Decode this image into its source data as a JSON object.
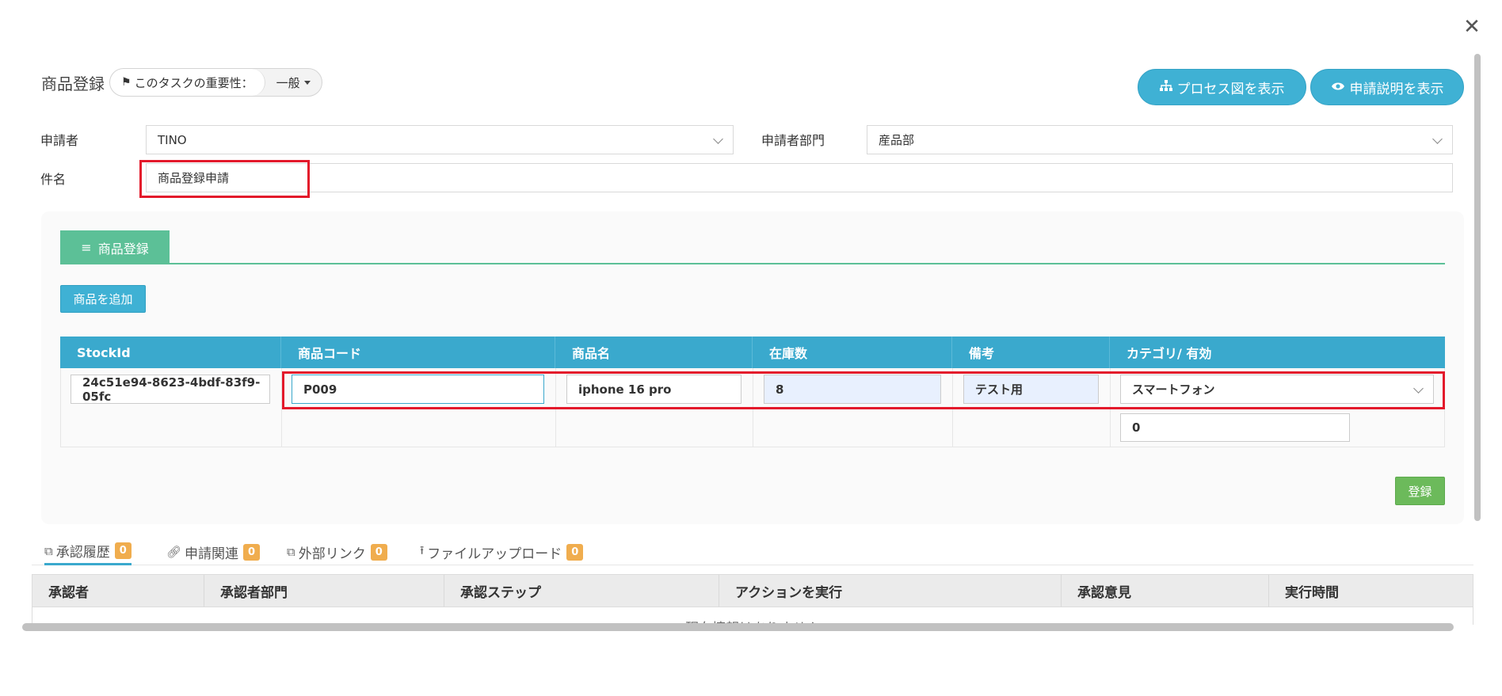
{
  "dialog": {
    "close_glyph": "✕"
  },
  "header": {
    "title": "商品登録",
    "priority_label": "このタスクの重要性：",
    "priority_value": "一般",
    "process_button": "プロセス図を表示",
    "explain_button": "申請説明を表示"
  },
  "form": {
    "applicant_label": "申請者",
    "applicant_value": "TINO",
    "department_label": "申請者部門",
    "department_value": "産品部",
    "subject_label": "件名",
    "subject_value": "商品登録申請"
  },
  "product_section": {
    "tab_label": "商品登録",
    "add_button": "商品を追加",
    "columns": [
      "StockId",
      "商品コード",
      "商品名",
      "在庫数",
      "備考",
      "カテゴリ/ 有効"
    ],
    "row": {
      "stock_id": "24c51e94-8623-4bdf-83f9-05fc",
      "product_code": "P009",
      "product_name": "iphone 16 pro",
      "stock_qty": "8",
      "note": "テスト用",
      "category": "スマートフォン",
      "active": "0"
    },
    "save_button": "登録"
  },
  "approval_tabs": [
    {
      "label": "承認履歴",
      "count": "0",
      "icon": "copy-icon"
    },
    {
      "label": "申請関連",
      "count": "0",
      "icon": "link-icon"
    },
    {
      "label": "外部リンク",
      "count": "0",
      "icon": "copy-icon"
    },
    {
      "label": "ファイルアップロード",
      "count": "0",
      "icon": "upload-icon"
    }
  ],
  "history_table": {
    "columns": [
      "承認者",
      "承認者部門",
      "承認ステップ",
      "アクションを実行",
      "承認意見",
      "実行時間"
    ],
    "empty_text": "現在情報はありません"
  },
  "colors": {
    "accent_blue": "#3aa9cd",
    "tab_green": "#5cc097",
    "save_green": "#6cba5b",
    "badge_orange": "#f0ad4e",
    "highlight_red": "#e3192b"
  }
}
